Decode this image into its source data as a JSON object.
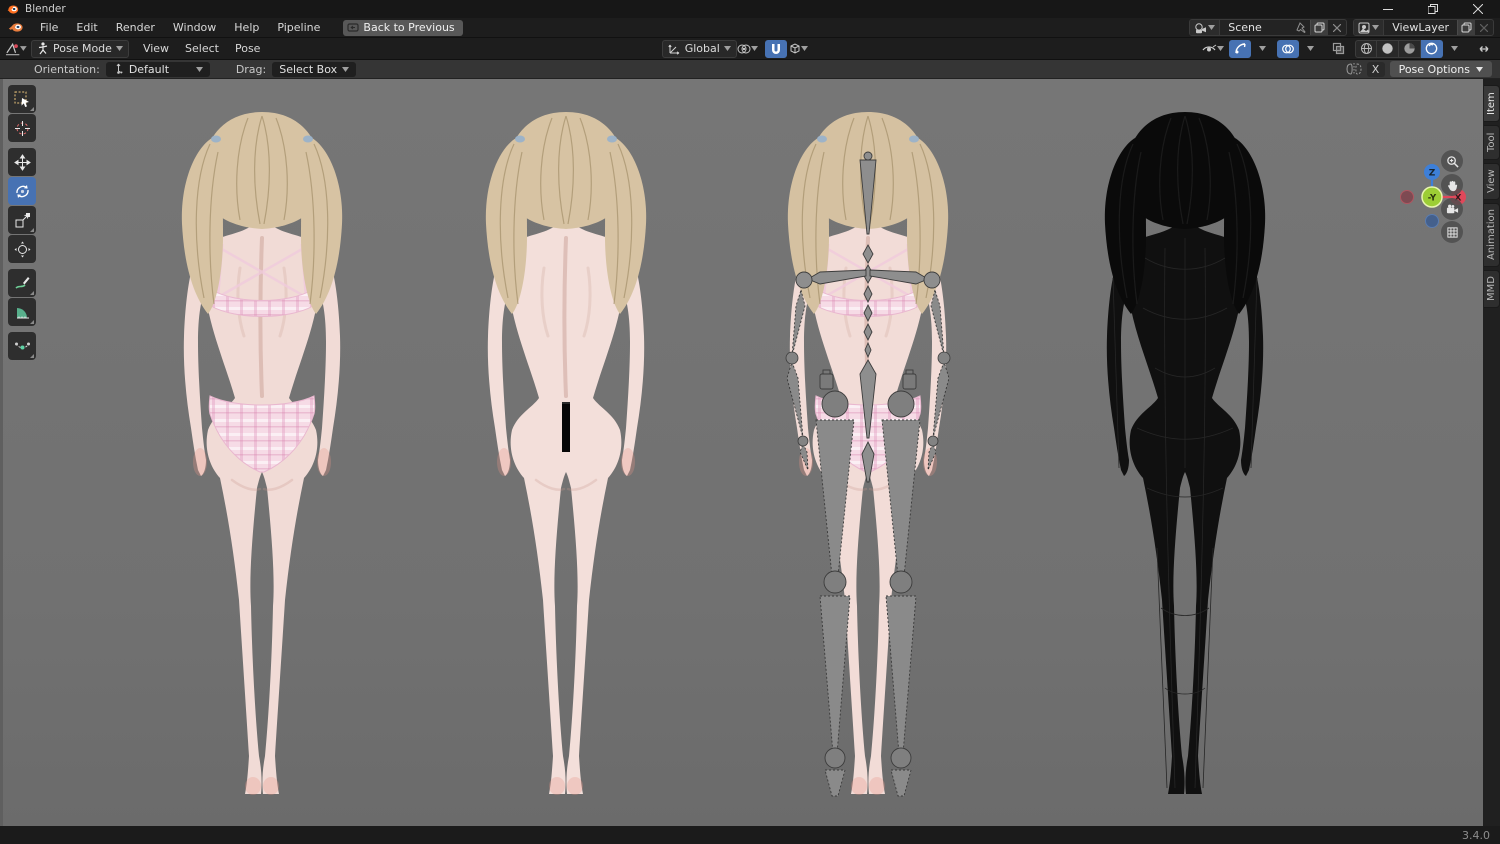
{
  "window": {
    "title": "Blender"
  },
  "menubar": {
    "menus": [
      "File",
      "Edit",
      "Render",
      "Window",
      "Help",
      "Pipeline"
    ],
    "back_button": "Back to Previous"
  },
  "scene_selector": {
    "label": "Scene"
  },
  "viewlayer_selector": {
    "label": "ViewLayer"
  },
  "viewport_header": {
    "mode": "Pose Mode",
    "menus": [
      "View",
      "Select",
      "Pose"
    ],
    "orientation": "Global"
  },
  "tool_settings": {
    "orientation_label": "Orientation:",
    "orientation_value": "Default",
    "drag_label": "Drag:",
    "drag_value": "Select Box",
    "mirror_x_label": "X",
    "pose_options_label": "Pose Options"
  },
  "toolbar": {
    "tools": [
      "tweak-select",
      "cursor",
      "move",
      "rotate",
      "scale",
      "transform",
      "annotate",
      "measure",
      "pose-breakdowner"
    ],
    "active_tool": "rotate"
  },
  "gizmo": {
    "axes": {
      "z": "Z",
      "x": "X",
      "y": "-Y"
    }
  },
  "nav_buttons": [
    "zoom",
    "pan",
    "camera-view",
    "toggle-orthographic"
  ],
  "sidebar_tabs": [
    "Item",
    "Tool",
    "View",
    "Animation",
    "MMD"
  ],
  "statusbar": {
    "version": "3.4.0"
  },
  "colors": {
    "accent_blue": "#4772b3",
    "axis_x": "#e0485a",
    "axis_y": "#9ccd35",
    "axis_z": "#3d7fd8",
    "viewport_bg": "#737373",
    "skin": "#f1dbd6",
    "hair": "#d7c3a3",
    "underwear_pink": "#f6dbe6",
    "bone_grey": "#8c8c8c",
    "wireframe_black": "#0e0e0e"
  }
}
